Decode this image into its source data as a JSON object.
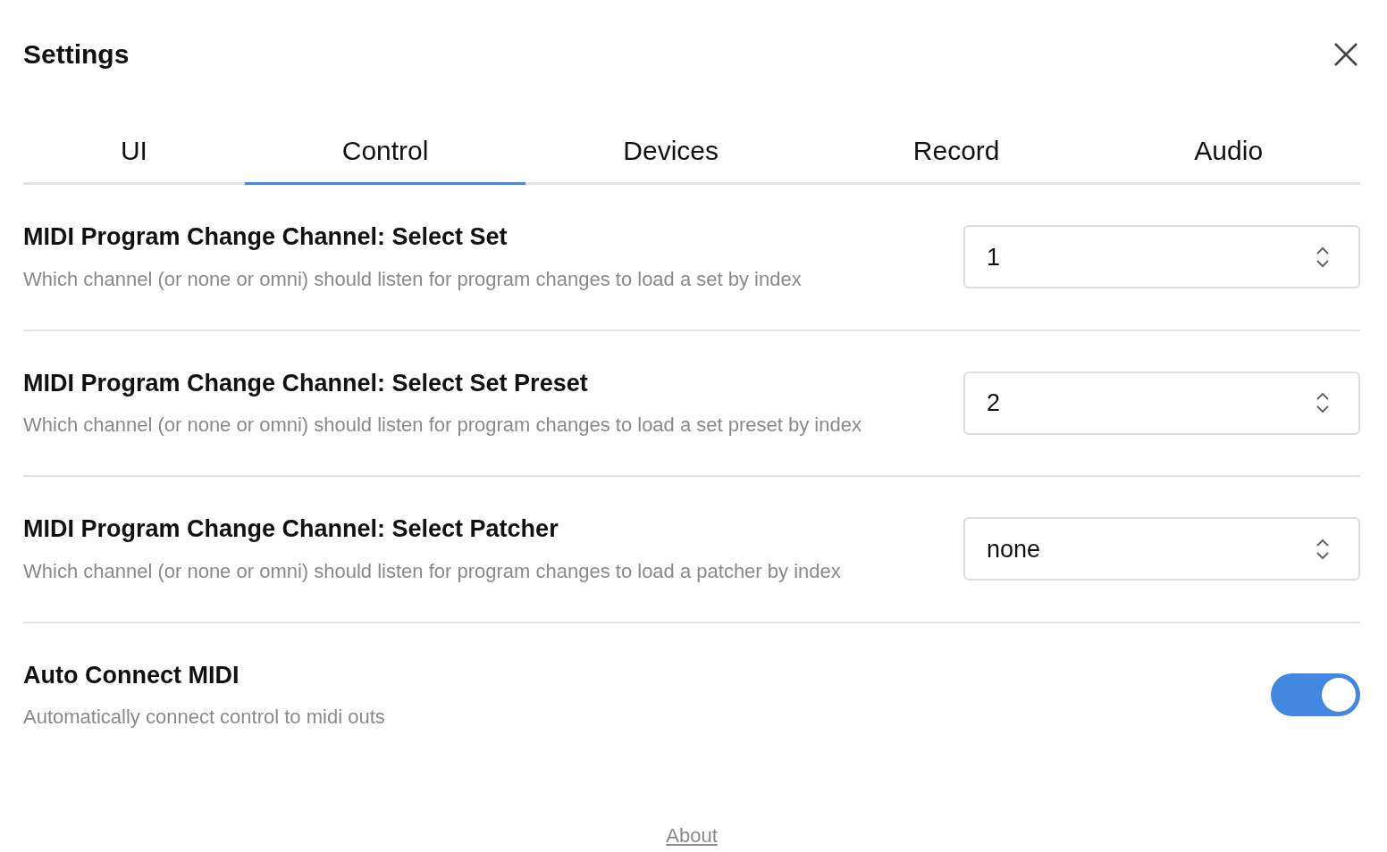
{
  "title": "Settings",
  "tabs": [
    {
      "label": "UI",
      "selected": false
    },
    {
      "label": "Control",
      "selected": true
    },
    {
      "label": "Devices",
      "selected": false
    },
    {
      "label": "Record",
      "selected": false
    },
    {
      "label": "Audio",
      "selected": false
    }
  ],
  "settings": [
    {
      "kind": "select",
      "title": "MIDI Program Change Channel: Select Set",
      "description": "Which channel (or none or omni) should listen for program changes to load a set by index",
      "value": "1"
    },
    {
      "kind": "select",
      "title": "MIDI Program Change Channel: Select Set Preset",
      "description": "Which channel (or none or omni) should listen for program changes to load a set preset by index",
      "value": "2"
    },
    {
      "kind": "select",
      "title": "MIDI Program Change Channel: Select Patcher",
      "description": "Which channel (or none or omni) should listen for program changes to load a patcher by index",
      "value": "none"
    },
    {
      "kind": "toggle",
      "title": "Auto Connect MIDI",
      "description": "Automatically connect control to midi outs",
      "on": true
    }
  ],
  "footer_link": "About"
}
